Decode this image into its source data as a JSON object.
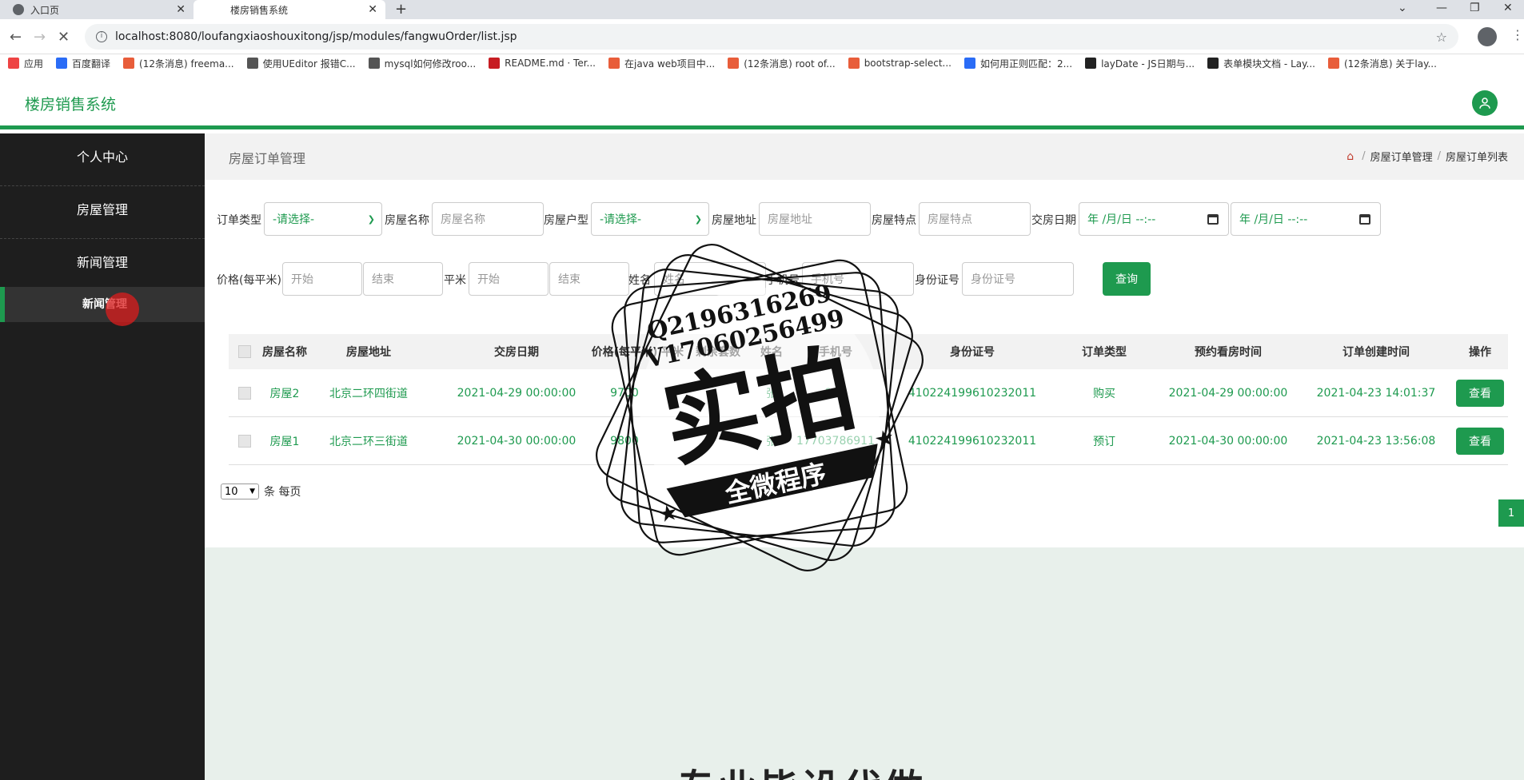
{
  "browser": {
    "tabs": [
      {
        "title": "入口页",
        "active": false
      },
      {
        "title": "楼房销售系统",
        "active": true
      }
    ],
    "url": "localhost:8080/loufangxiaoshouxitong/jsp/modules/fangwuOrder/list.jsp",
    "bookmarks": [
      {
        "label": "应用",
        "color": "#e44"
      },
      {
        "label": "百度翻译",
        "color": "#2a6cf6"
      },
      {
        "label": "(12条消息) freema...",
        "color": "#e85d3a"
      },
      {
        "label": "使用UEditor 报错C...",
        "color": "#555"
      },
      {
        "label": "mysql如何修改roo...",
        "color": "#555"
      },
      {
        "label": "README.md · Ter...",
        "color": "#c71d23"
      },
      {
        "label": "在java web项目中...",
        "color": "#e85d3a"
      },
      {
        "label": "(12条消息) root of...",
        "color": "#e85d3a"
      },
      {
        "label": "bootstrap-select...",
        "color": "#e85d3a"
      },
      {
        "label": "如何用正则匹配：2...",
        "color": "#2a6cf6"
      },
      {
        "label": "layDate - JS日期与...",
        "color": "#222"
      },
      {
        "label": "表单模块文档 - Lay...",
        "color": "#222"
      },
      {
        "label": "(12条消息) 关于lay...",
        "color": "#e85d3a"
      }
    ]
  },
  "app": {
    "title": "楼房销售系统"
  },
  "sidebar": {
    "items": [
      {
        "label": "个人中心"
      },
      {
        "label": "房屋管理"
      },
      {
        "label": "新闻管理"
      }
    ],
    "sub_item": "新闻管理"
  },
  "main": {
    "title": "房屋订单管理",
    "breadcrumb": [
      "房屋订单管理",
      "房屋订单列表"
    ]
  },
  "filters": {
    "order_type_label": "订单类型",
    "order_type_value": "-请选择-",
    "house_name_label": "房屋名称",
    "house_name_placeholder": "房屋名称",
    "house_type_label": "房屋户型",
    "house_type_value": "-请选择-",
    "house_addr_label": "房屋地址",
    "house_addr_placeholder": "房屋地址",
    "house_feature_label": "房屋特点",
    "house_feature_placeholder": "房屋特点",
    "delivery_date_label": "交房日期",
    "date_placeholder": "年 /月/日 --:--",
    "price_label": "价格(每平米)",
    "start_placeholder": "开始",
    "end_placeholder": "结束",
    "area_label": "平米",
    "name_label": "姓名",
    "name_placeholder": "姓名",
    "phone_label": "手机号",
    "phone_placeholder": "手机号",
    "idcard_label": "身份证号",
    "idcard_placeholder": "身份证号",
    "query_button": "查询"
  },
  "table": {
    "headers": [
      "房屋名称",
      "房屋地址",
      "交房日期",
      "价格(每平米)",
      "平米",
      "剩余套数",
      "姓名",
      "手机号",
      "身份证号",
      "订单类型",
      "预约看房时间",
      "订单创建时间",
      "操作"
    ],
    "rows": [
      {
        "name": "房屋2",
        "addr": "北京二环四街道",
        "delivery": "2021-04-29 00:00:00",
        "price": "9700",
        "area": "97",
        "remain": "",
        "person": "张",
        "phone": "911",
        "idcard": "410224199610232011",
        "type": "购买",
        "visit": "2021-04-29 00:00:00",
        "created": "2021-04-23 14:01:37",
        "action": "查看"
      },
      {
        "name": "房屋1",
        "addr": "北京二环三街道",
        "delivery": "2021-04-30 00:00:00",
        "price": "9800",
        "area": "",
        "remain": "",
        "person": "张",
        "phone": "17703786911",
        "idcard": "410224199610232011",
        "type": "预订",
        "visit": "2021-04-30 00:00:00",
        "created": "2021-04-23 13:56:08",
        "action": "查看"
      }
    ]
  },
  "pager": {
    "page_size": "10",
    "per_page_label": "条 每页",
    "current_page": "1"
  },
  "watermark": {
    "line1": "Q2196316269",
    "line2": "V17060256499",
    "big": "实拍",
    "banner": "全微程序"
  },
  "lower_banner": "专业毕设代做"
}
